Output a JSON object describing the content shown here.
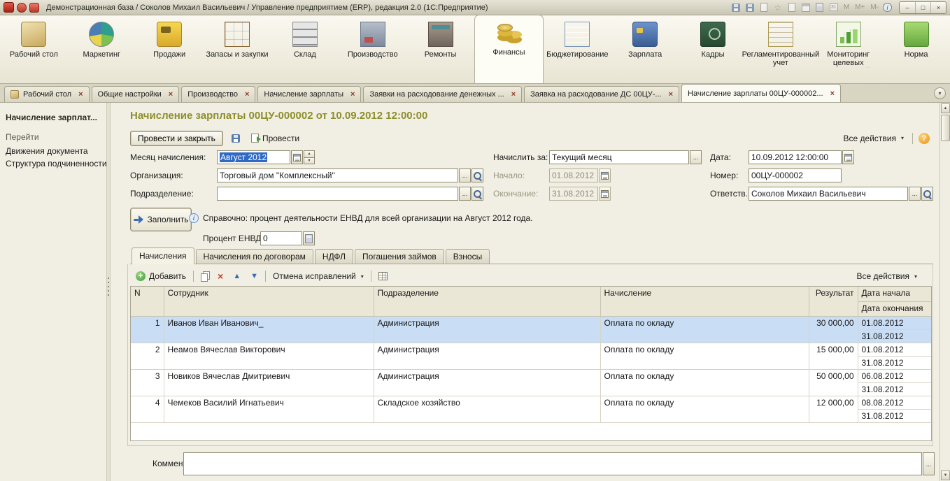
{
  "colors": {
    "title_accent": "#8e8e2c",
    "selection_row": "#c9ddf4",
    "text_selection": "#316ac5"
  },
  "icons": {
    "dropdown": "▾",
    "close": "×",
    "min": "–",
    "max": "□",
    "x": "×",
    "spin_up": "▴",
    "spin_down": "▾",
    "arrow_up": "▲",
    "arrow_down": "▼",
    "ellipsis": "...",
    "help": "?",
    "info": "i",
    "plus": "+",
    "scroll_up": "▲",
    "scroll_down": "▼"
  },
  "titlebar": {
    "title": "Демонстрационная база / Соколов Михаил Васильевич / Управление предприятием (ERP), редакция 2.0 (1С:Предприятие)",
    "mem": [
      "M",
      "M+",
      "M-"
    ]
  },
  "ribbon": {
    "sections": [
      {
        "label": "Рабочий стол"
      },
      {
        "label": "Маркетинг"
      },
      {
        "label": "Продажи"
      },
      {
        "label": "Запасы и закупки"
      },
      {
        "label": "Склад"
      },
      {
        "label": "Производство"
      },
      {
        "label": "Ремонты"
      },
      {
        "label": "Финансы"
      },
      {
        "label": "Бюджетирование"
      },
      {
        "label": "Зарплата"
      },
      {
        "label": "Кадры"
      },
      {
        "label": "Регламентированный учет"
      },
      {
        "label": "Мониторинг целевых показателей"
      },
      {
        "label": "Норма"
      }
    ]
  },
  "tabs": {
    "items": [
      {
        "label": "Рабочий стол"
      },
      {
        "label": "Общие настройки"
      },
      {
        "label": "Производство"
      },
      {
        "label": "Начисление зарплаты"
      },
      {
        "label": "Заявки на расходование денежных ..."
      },
      {
        "label": "Заявка на расходование ДС 00ЦУ-..."
      },
      {
        "label": "Начисление зарплаты 00ЦУ-000002..."
      }
    ]
  },
  "sidebar": {
    "title": "Начисление зарплат...",
    "goto": "Перейти",
    "links": [
      {
        "label": "Движения документа"
      },
      {
        "label": "Структура подчиненности"
      }
    ]
  },
  "doc": {
    "title": "Начисление зарплаты 00ЦУ-000002 от 10.09.2012 12:00:00",
    "post_close": "Провести и закрыть",
    "post": "Провести",
    "all_actions": "Все действия",
    "fields": {
      "month_label": "Месяц начисления:",
      "month_value": "Август 2012",
      "accrue_label": "Начислить за:",
      "accrue_value": "Текущий месяц",
      "date_label": "Дата:",
      "date_value": "10.09.2012 12:00:00",
      "org_label": "Организация:",
      "org_value": "Торговый дом \"Комплексный\"",
      "begin_label": "Начало:",
      "begin_value": "01.08.2012",
      "number_label": "Номер:",
      "number_value": "00ЦУ-000002",
      "dept_label": "Подразделение:",
      "dept_value": "",
      "end_label": "Окончание:",
      "end_value": "31.08.2012",
      "resp_label": "Ответств.:",
      "resp_value": "Соколов Михаил Васильевич"
    },
    "fill_button": "Заполнить",
    "info_text": "Справочно: процент деятельности ЕНВД для всей организации на Август 2012 года.",
    "percent_label": "Процент ЕНВД:",
    "percent_value": "0",
    "comment_label": "Комментарий:",
    "comment_value": ""
  },
  "inner_tabs": {
    "items": [
      {
        "label": "Начисления"
      },
      {
        "label": "Начисления по договорам"
      },
      {
        "label": "НДФЛ"
      },
      {
        "label": "Погашения займов"
      },
      {
        "label": "Взносы"
      }
    ]
  },
  "grid": {
    "toolbar": {
      "add": "Добавить",
      "undo": "Отмена исправлений",
      "all_actions": "Все действия"
    },
    "headers": {
      "n": "N",
      "employee": "Сотрудник",
      "department": "Подразделение",
      "accrual": "Начисление",
      "result": "Результат",
      "date_start": "Дата начала",
      "date_end": "Дата окончания"
    },
    "rows": [
      {
        "n": "1",
        "employee": "Иванов Иван Иванович_",
        "department": "Администрация",
        "accrual": "Оплата по окладу",
        "result": "30 000,00",
        "date_start": "01.08.2012",
        "date_end": "31.08.2012"
      },
      {
        "n": "2",
        "employee": "Неамов Вячеслав Викторович",
        "department": "Администрация",
        "accrual": "Оплата по окладу",
        "result": "15 000,00",
        "date_start": "01.08.2012",
        "date_end": "31.08.2012"
      },
      {
        "n": "3",
        "employee": "Новиков Вячеслав Дмитриевич",
        "department": "Администрация",
        "accrual": "Оплата по окладу",
        "result": "50 000,00",
        "date_start": "06.08.2012",
        "date_end": "31.08.2012"
      },
      {
        "n": "4",
        "employee": "Чемеков Василий Игнатьевич",
        "department": "Складское хозяйство",
        "accrual": "Оплата по окладу",
        "result": "12 000,00",
        "date_start": "08.08.2012",
        "date_end": "31.08.2012"
      }
    ]
  }
}
